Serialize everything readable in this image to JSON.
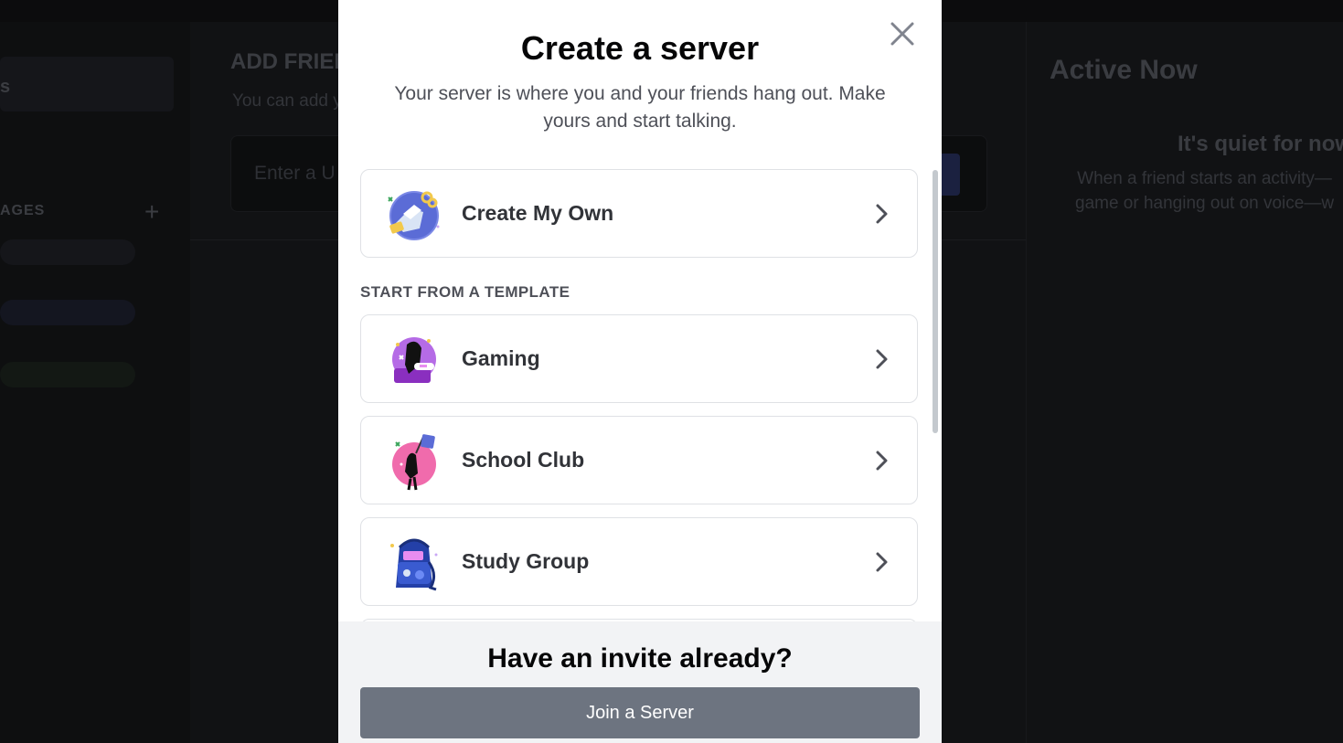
{
  "background": {
    "sidebar_text": "s",
    "dm_label": "AGES",
    "add_friend_title": "ADD FRIEN",
    "add_friend_subtitle": "You can add y",
    "input_placeholder": "Enter a U",
    "active_now_title": "Active Now",
    "quiet_title": "It's quiet for now",
    "quiet_line1": "When a friend starts an activity—",
    "quiet_line2": "game or hanging out on voice—w"
  },
  "modal": {
    "title": "Create a server",
    "subtitle": "Your server is where you and your friends hang out. Make yours and start talking.",
    "create_own": {
      "label": "Create My Own",
      "icon": "create-own-icon"
    },
    "template_section": "START FROM A TEMPLATE",
    "templates": [
      {
        "label": "Gaming",
        "icon": "gaming-icon"
      },
      {
        "label": "School Club",
        "icon": "school-club-icon"
      },
      {
        "label": "Study Group",
        "icon": "study-group-icon"
      }
    ],
    "footer_title": "Have an invite already?",
    "join_button": "Join a Server"
  },
  "colors": {
    "modal_bg": "#ffffff",
    "footer_bg": "#f2f3f5",
    "join_button_bg": "#6d7480",
    "text_primary": "#060607",
    "text_secondary": "#4e5058"
  }
}
